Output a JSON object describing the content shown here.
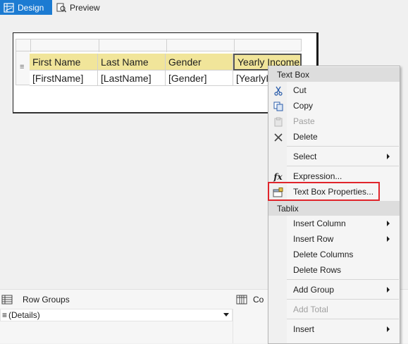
{
  "tabs": {
    "design": "Design",
    "preview": "Preview"
  },
  "tablix": {
    "headers": [
      "First Name",
      "Last Name",
      "Gender",
      "Yearly Income"
    ],
    "cells": [
      "[FirstName]",
      "[LastName]",
      "[Gender]",
      "[YearlyIn"
    ],
    "row_handle": "≡"
  },
  "bottom": {
    "row_groups_title": "Row Groups",
    "row_group_item": "(Details)",
    "row_group_prefix": "≡",
    "column_groups_title": "Co"
  },
  "menu": {
    "section1": "Text Box",
    "cut": "Cut",
    "copy": "Copy",
    "paste": "Paste",
    "delete": "Delete",
    "select": "Select",
    "expression": "Expression...",
    "text_box_properties": "Text Box Properties...",
    "section2": "Tablix",
    "insert_column": "Insert Column",
    "insert_row": "Insert Row",
    "delete_columns": "Delete Columns",
    "delete_rows": "Delete Rows",
    "add_group": "Add Group",
    "add_total": "Add Total",
    "insert": "Insert"
  },
  "colors": {
    "accent": "#1c7bd2",
    "header_fill": "#f1e59a",
    "highlight": "#e0252b"
  }
}
